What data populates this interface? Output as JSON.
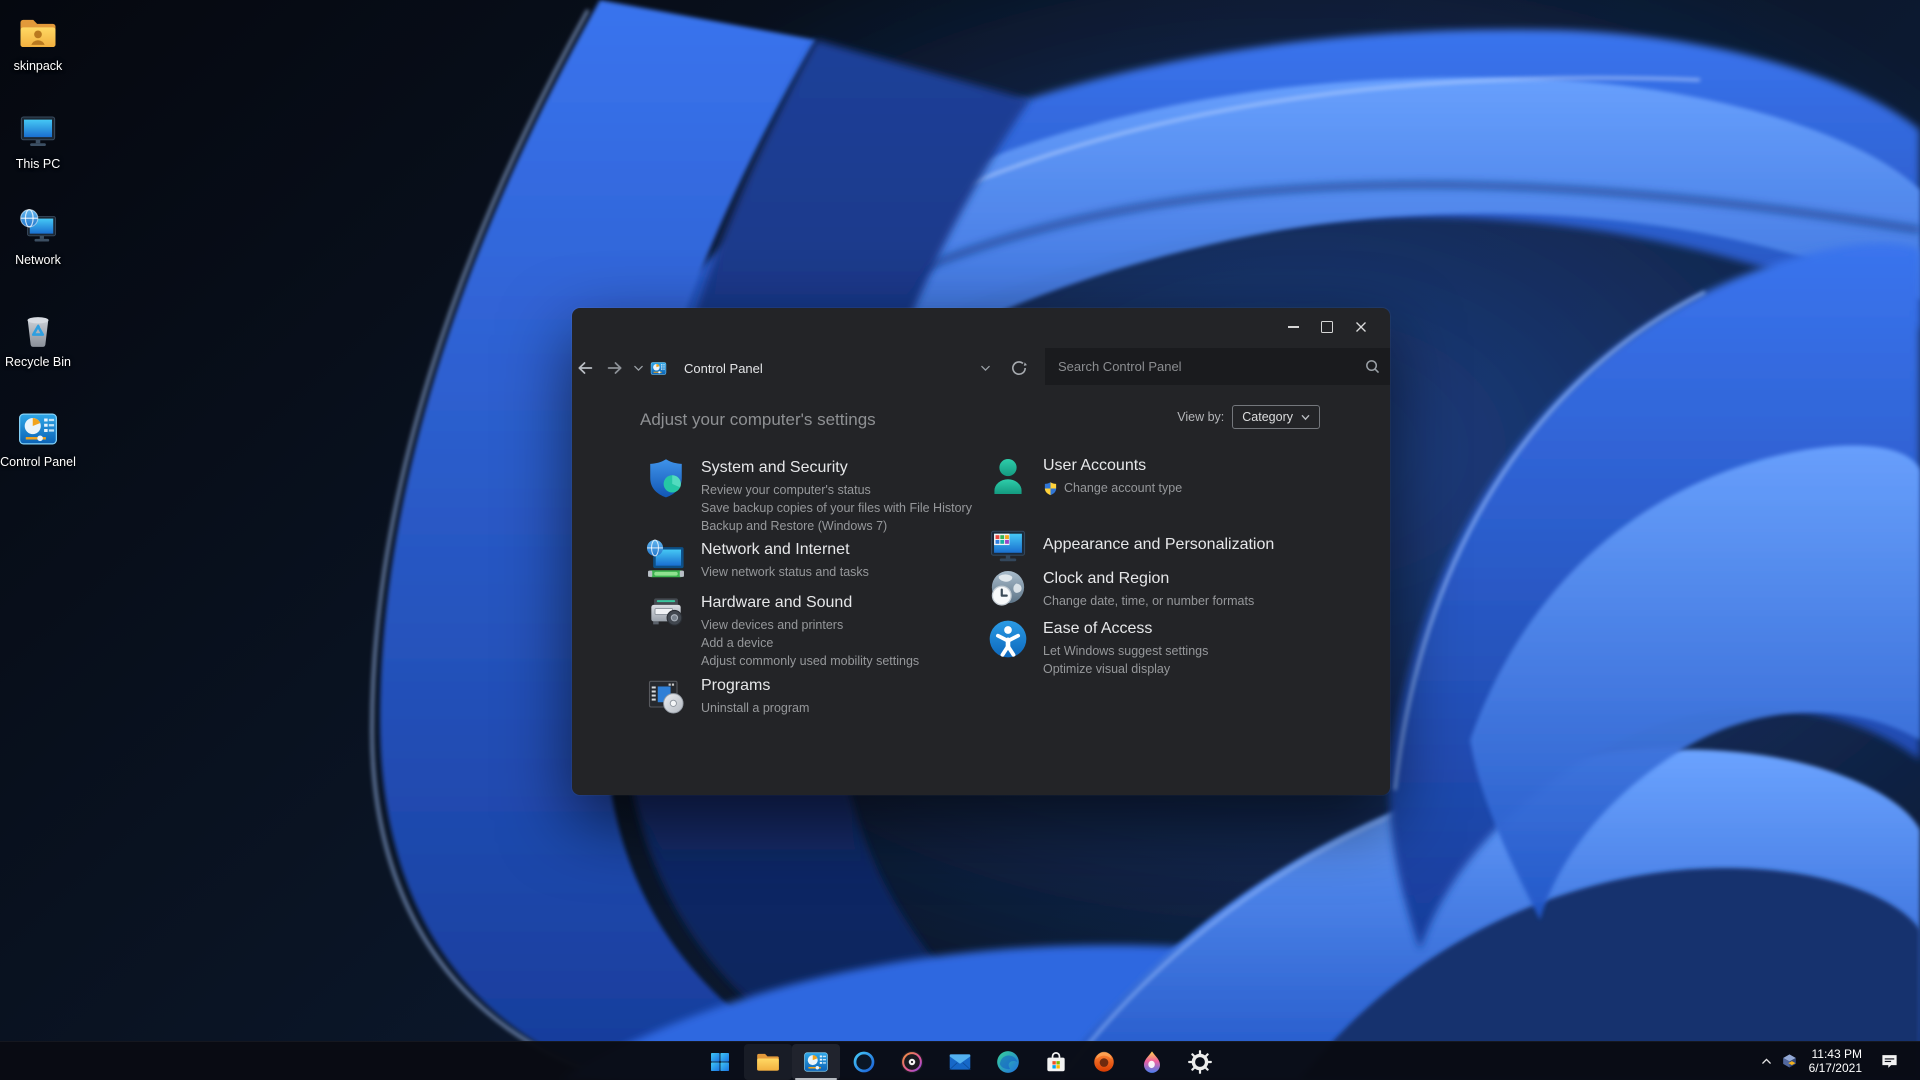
{
  "desktop": {
    "icons": [
      {
        "label": "skinpack",
        "icon": "user-folder-icon"
      },
      {
        "label": "This PC",
        "icon": "computer-monitor-icon"
      },
      {
        "label": "Network",
        "icon": "network-globe-monitor-icon"
      },
      {
        "label": "Recycle Bin",
        "icon": "recycle-bin-icon"
      },
      {
        "label": "Control Panel",
        "icon": "control-panel-icon"
      }
    ]
  },
  "window": {
    "nav": {
      "title": "Control Panel",
      "search_placeholder": "Search Control Panel"
    },
    "header": {
      "heading": "Adjust your computer's settings",
      "view_by_label": "View by:",
      "view_by_value": "Category"
    },
    "categories": {
      "left": [
        {
          "title": "System and Security",
          "icon": "shield-icon",
          "links": [
            "Review your computer's status",
            "Save backup copies of your files with File History",
            "Backup and Restore (Windows 7)"
          ]
        },
        {
          "title": "Network and Internet",
          "icon": "network-monitor-icon",
          "links": [
            "View network status and tasks"
          ]
        },
        {
          "title": "Hardware and Sound",
          "icon": "printer-icon",
          "links": [
            "View devices and printers",
            "Add a device",
            "Adjust commonly used mobility settings"
          ]
        },
        {
          "title": "Programs",
          "icon": "programs-disc-icon",
          "links": [
            "Uninstall a program"
          ]
        }
      ],
      "right": [
        {
          "title": "User Accounts",
          "icon": "user-icon",
          "links": [
            "Change account type"
          ]
        },
        {
          "title": "Appearance and Personalization",
          "icon": "appearance-monitor-icon",
          "links": []
        },
        {
          "title": "Clock and Region",
          "icon": "clock-globe-icon",
          "links": [
            "Change date, time, or number formats"
          ]
        },
        {
          "title": "Ease of Access",
          "icon": "ease-of-access-icon",
          "links": [
            "Let Windows suggest settings",
            "Optimize visual display"
          ]
        }
      ]
    }
  },
  "taskbar": {
    "apps": [
      {
        "name": "start",
        "icon": "windows-logo-icon"
      },
      {
        "name": "file-explorer",
        "icon": "folder-icon",
        "open": true
      },
      {
        "name": "control-panel",
        "icon": "control-panel-icon",
        "active": true
      },
      {
        "name": "cortana",
        "icon": "cortana-ring-icon"
      },
      {
        "name": "groove-music",
        "icon": "music-disc-icon"
      },
      {
        "name": "mail",
        "icon": "mail-envelope-icon"
      },
      {
        "name": "edge",
        "icon": "edge-browser-icon"
      },
      {
        "name": "microsoft-store",
        "icon": "store-bag-icon"
      },
      {
        "name": "office",
        "icon": "office-icon"
      },
      {
        "name": "paint-3d",
        "icon": "paint-droplet-icon"
      },
      {
        "name": "settings",
        "icon": "gear-icon"
      }
    ],
    "tray": {
      "time": "11:43 PM",
      "date": "6/17/2021"
    }
  },
  "colors": {
    "accent_blue": "#2f7fd6",
    "window_bg": "#232427",
    "search_bg": "#1a1b1e",
    "taskbar_bg": "#090b13",
    "title_text": "#e6e7e9",
    "link_text": "#96989b",
    "wallpaper_blue": "#3a74ee"
  }
}
